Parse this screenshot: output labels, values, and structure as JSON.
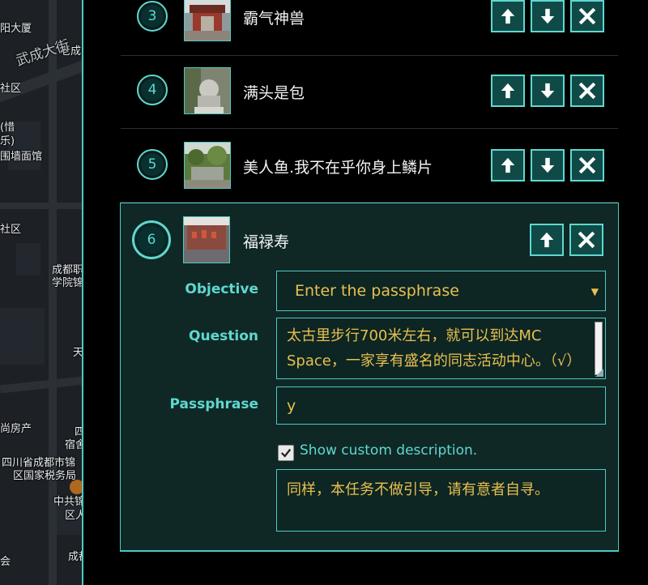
{
  "map": {
    "labels": [
      "阳大厦",
      "老成",
      "武成大街",
      "社区",
      "(惜",
      "乐)",
      "围墙面馆",
      "社区",
      "成都职",
      "学院锦",
      "天",
      "尚房产",
      "四",
      "宿舍",
      "四川省成都市锦",
      "区国家税务局",
      "中共锦",
      "区人",
      "会",
      "成都"
    ]
  },
  "items": [
    {
      "number": "3",
      "title": "霸气神兽"
    },
    {
      "number": "4",
      "title": "满头是包"
    },
    {
      "number": "5",
      "title": "美人鱼.我不在乎你身上鳞片"
    },
    {
      "number": "6",
      "title": "福禄寿"
    }
  ],
  "editor": {
    "objective_label": "Objective",
    "objective_value": "Enter the passphrase",
    "question_label": "Question",
    "question_value": "太古里步行700米左右，就可以到达MC Space，一家享有盛名的同志活动中心。（√）",
    "passphrase_label": "Passphrase",
    "passphrase_value": "y",
    "show_custom_label": "Show custom description.",
    "show_custom_checked": true,
    "description_value": "同样，本任务不做引导，请有意者自寻。"
  },
  "icons": {
    "up": "arrow-up-icon",
    "down": "arrow-down-icon",
    "delete": "close-icon",
    "dropdown": "caret-down-icon",
    "check": "checkmark-icon"
  },
  "colors": {
    "accent": "#5fd8d0",
    "field_text": "#e8c04f",
    "panel_bg": "#0f2826",
    "button_bg": "#0f4a47"
  }
}
